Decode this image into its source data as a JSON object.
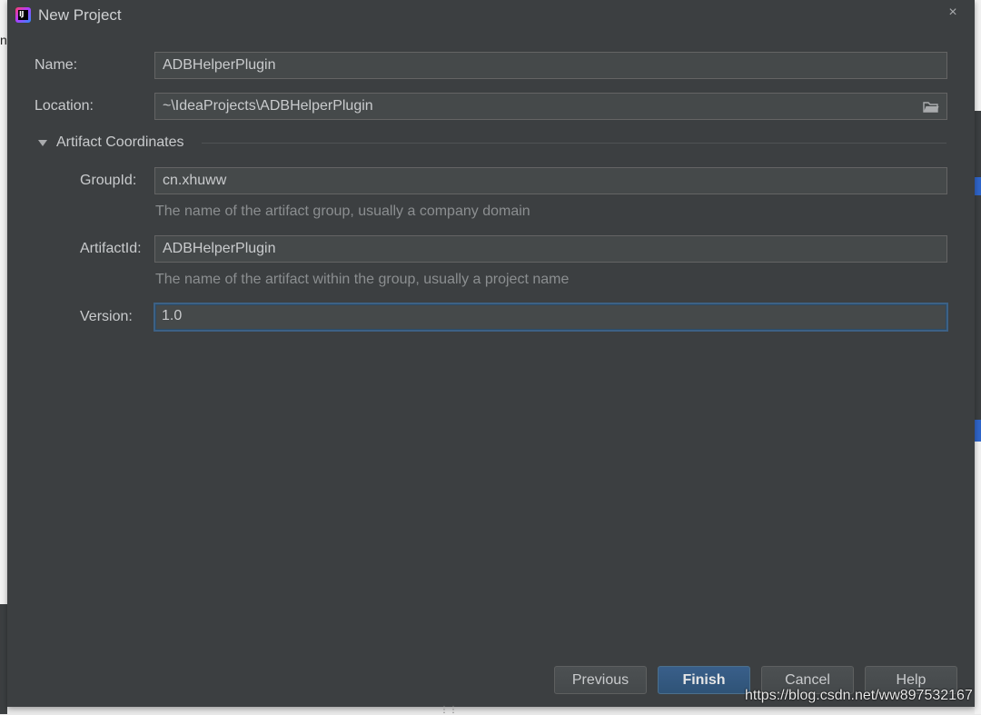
{
  "background": {
    "left_fragment": "n"
  },
  "dialog": {
    "title": "New Project",
    "close_glyph": "×",
    "app_icon_text": "IJ"
  },
  "form": {
    "name_label": "Name:",
    "name_value": "ADBHelperPlugin",
    "location_label": "Location:",
    "location_value": "~\\IdeaProjects\\ADBHelperPlugin",
    "section_title": "Artifact Coordinates",
    "groupid_label": "GroupId:",
    "groupid_value": "cn.xhuww",
    "groupid_hint": "The name of the artifact group, usually a company domain",
    "artifactid_label": "ArtifactId:",
    "artifactid_value": "ADBHelperPlugin",
    "artifactid_hint": "The name of the artifact within the group, usually a project name",
    "version_label": "Version:",
    "version_value": "1.0"
  },
  "buttons": {
    "previous": "Previous",
    "finish": "Finish",
    "cancel": "Cancel",
    "help": "Help"
  },
  "watermark": "https://blog.csdn.net/ww897532167",
  "icons": {
    "folder": "folder-icon",
    "expand": "triangle-down-icon",
    "close": "close-icon",
    "app": "intellij-idea-icon"
  },
  "colors": {
    "dialog_bg": "#3c3f41",
    "field_bg": "#45494a",
    "primary_button": "#365880",
    "focus_border": "#3d6185"
  }
}
